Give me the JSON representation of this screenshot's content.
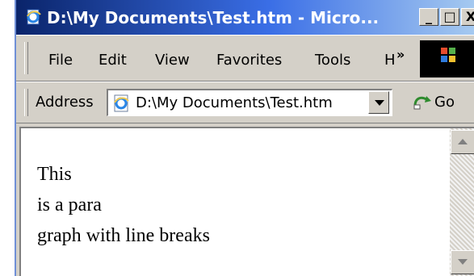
{
  "window": {
    "title": "D:\\My Documents\\Test.htm - Micro...",
    "minimize": "_",
    "maximize": "□",
    "close": "X"
  },
  "menu": {
    "items": [
      "File",
      "Edit",
      "View",
      "Favorites",
      "Tools",
      "H"
    ],
    "overflow": "»"
  },
  "address": {
    "label": "Address",
    "value": "D:\\My Documents\\Test.htm",
    "go_label": "Go"
  },
  "content": {
    "lines": [
      "This",
      "is a para",
      "graph with line breaks"
    ]
  },
  "icons": {
    "page_icon": "ie-page-icon",
    "go_icon": "go-arrow-icon",
    "logo": "windows-logo"
  }
}
